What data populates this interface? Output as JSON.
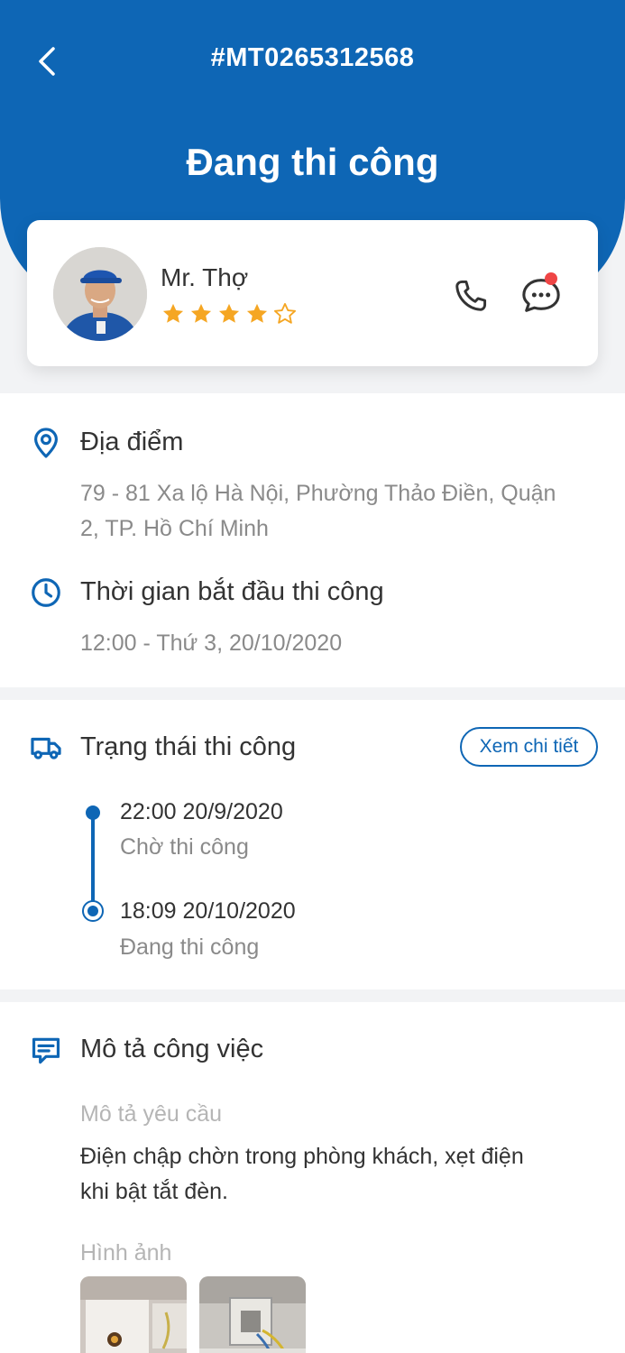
{
  "header": {
    "order_id": "#MT0265312568",
    "status_title": "Đang thi công"
  },
  "worker": {
    "name": "Mr. Thợ",
    "rating": 4,
    "rating_max": 5,
    "notification": true
  },
  "location": {
    "heading": "Địa điểm",
    "address_line1": "79 - 81 Xa lộ Hà Nội, Phường Thảo Điền, Quận",
    "address_line2": "2, TP. Hồ Chí Minh"
  },
  "start_time": {
    "heading": "Thời gian bắt đầu thi công",
    "value": "12:00 - Thứ 3, 20/10/2020"
  },
  "construction_status": {
    "heading": "Trạng thái thi công",
    "detail_button": "Xem chi tiết",
    "timeline": [
      {
        "time": "22:00 20/9/2020",
        "label": "Chờ thi công"
      },
      {
        "time": "18:09 20/10/2020",
        "label": "Đang thi công"
      }
    ]
  },
  "job_description": {
    "heading": "Mô tả công việc",
    "request_label": "Mô tả yêu cầu",
    "request_line1": "Điện chập chờn trong phòng khách, xẹt điện",
    "request_line2": "khi bật tắt đèn.",
    "images_label": "Hình ảnh",
    "image_count": 2
  },
  "colors": {
    "primary": "#0e66b5",
    "star": "#f5a623",
    "notification": "#ef4545",
    "text_primary": "#333333",
    "text_secondary": "#8a8a8a"
  }
}
